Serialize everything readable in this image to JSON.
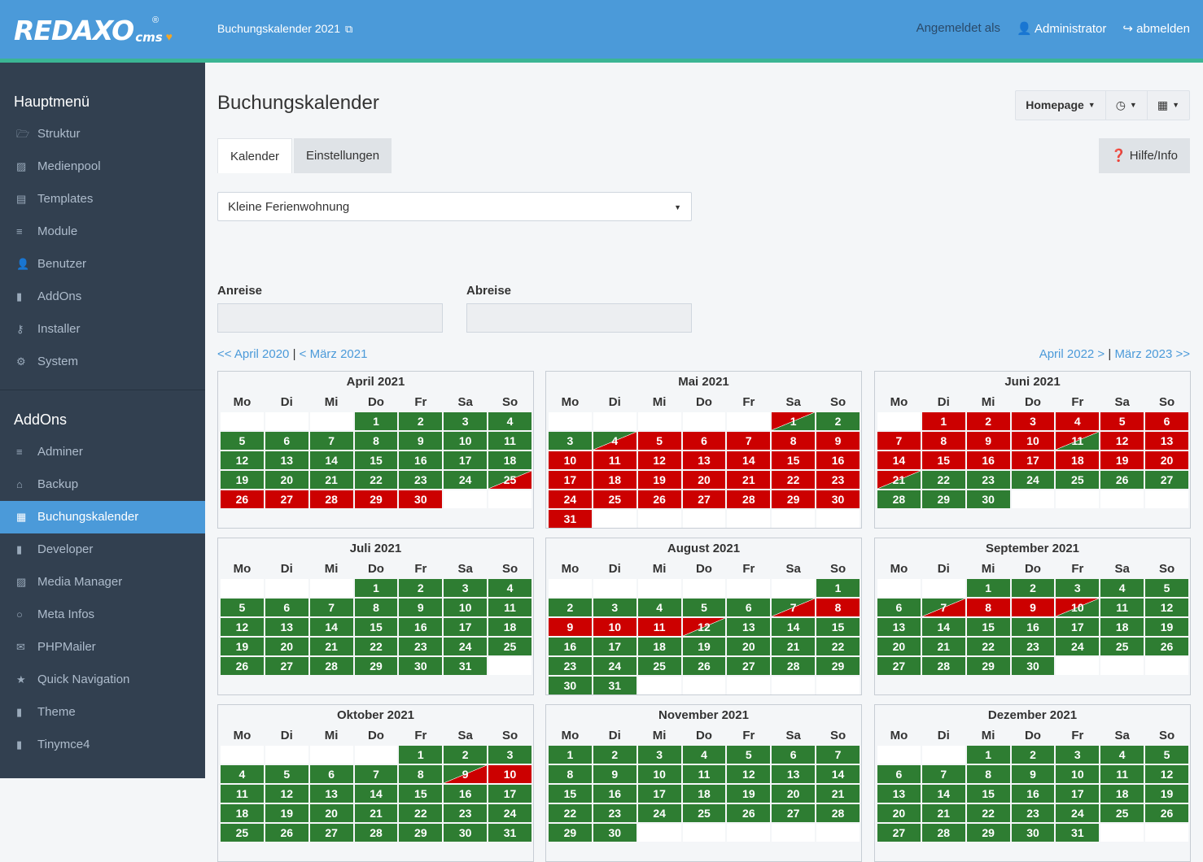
{
  "header": {
    "logo_text": "REDAXO",
    "logo_suffix": "cms",
    "site_link": "Buchungskalender 2021",
    "logged_in_label": "Angemeldet als",
    "user": "Administrator",
    "logout": "abmelden"
  },
  "sidebar": {
    "main_heading": "Hauptmenü",
    "main_items": [
      {
        "label": "Struktur",
        "icon": "folder-icon"
      },
      {
        "label": "Medienpool",
        "icon": "image-icon"
      },
      {
        "label": "Templates",
        "icon": "newspaper-icon"
      },
      {
        "label": "Module",
        "icon": "database-icon"
      },
      {
        "label": "Benutzer",
        "icon": "user-icon"
      },
      {
        "label": "AddOns",
        "icon": "bookmark-icon"
      },
      {
        "label": "Installer",
        "icon": "key-icon"
      },
      {
        "label": "System",
        "icon": "cogs-icon"
      }
    ],
    "addons_heading": "AddOns",
    "addon_items": [
      {
        "label": "Adminer",
        "icon": "database-icon"
      },
      {
        "label": "Backup",
        "icon": "hdd-icon"
      },
      {
        "label": "Buchungskalender",
        "icon": "calendar-icon",
        "active": true
      },
      {
        "label": "Developer",
        "icon": "bookmark-icon"
      },
      {
        "label": "Media Manager",
        "icon": "image-icon"
      },
      {
        "label": "Meta Infos",
        "icon": "circle-icon"
      },
      {
        "label": "PHPMailer",
        "icon": "envelope-icon"
      },
      {
        "label": "Quick Navigation",
        "icon": "star-icon"
      },
      {
        "label": "Theme",
        "icon": "bookmark-icon"
      },
      {
        "label": "Tinymce4",
        "icon": "bookmark-icon"
      }
    ]
  },
  "page": {
    "title": "Buchungskalender",
    "actions": {
      "homepage": "Homepage"
    },
    "tabs": [
      "Kalender",
      "Einstellungen"
    ],
    "help": "Hilfe/Info",
    "apartment": "Kleine Ferienwohnung",
    "arrival_label": "Anreise",
    "departure_label": "Abreise",
    "arrival_value": "",
    "departure_value": "",
    "nav_prev_year": "<< April 2020",
    "nav_prev_month": "< März 2021",
    "nav_next_month": "April 2022 >",
    "nav_next_year": "März 2023 >>",
    "nav_sep": "|"
  },
  "calendar": {
    "weekdays": [
      "Mo",
      "Di",
      "Mi",
      "Do",
      "Fr",
      "Sa",
      "So"
    ],
    "colors": {
      "free": "#2e7d32",
      "booked": "#cc0000"
    },
    "months": [
      {
        "title": "April 2021",
        "offset": 3,
        "days": 30,
        "booked": [
          26,
          27,
          28,
          29,
          30
        ],
        "arrival": [
          25
        ],
        "departure": []
      },
      {
        "title": "Mai 2021",
        "offset": 5,
        "days": 31,
        "booked": [
          5,
          6,
          7,
          8,
          9,
          10,
          11,
          12,
          13,
          14,
          15,
          16,
          17,
          18,
          19,
          20,
          21,
          22,
          23,
          24,
          25,
          26,
          27,
          28,
          29,
          30,
          31
        ],
        "arrival": [
          4
        ],
        "departure": [
          1
        ]
      },
      {
        "title": "Juni 2021",
        "offset": 1,
        "days": 30,
        "booked": [
          1,
          2,
          3,
          4,
          5,
          6,
          7,
          8,
          9,
          10,
          12,
          13,
          14,
          15,
          16,
          17,
          18,
          19,
          20
        ],
        "arrival": [],
        "departure": [
          11,
          21
        ]
      },
      {
        "title": "Juli 2021",
        "offset": 3,
        "days": 31,
        "booked": [],
        "arrival": [],
        "departure": []
      },
      {
        "title": "August 2021",
        "offset": 6,
        "days": 31,
        "booked": [
          8,
          9,
          10,
          11
        ],
        "arrival": [
          7
        ],
        "departure": [
          12
        ]
      },
      {
        "title": "September 2021",
        "offset": 2,
        "days": 30,
        "booked": [
          8,
          9
        ],
        "arrival": [
          7
        ],
        "departure": [
          10
        ]
      },
      {
        "title": "Oktober 2021",
        "offset": 4,
        "days": 31,
        "booked": [
          10
        ],
        "arrival": [
          9
        ],
        "departure": []
      },
      {
        "title": "November 2021",
        "offset": 0,
        "days": 30,
        "booked": [],
        "arrival": [],
        "departure": []
      },
      {
        "title": "Dezember 2021",
        "offset": 2,
        "days": 31,
        "booked": [],
        "arrival": [],
        "departure": []
      }
    ]
  }
}
